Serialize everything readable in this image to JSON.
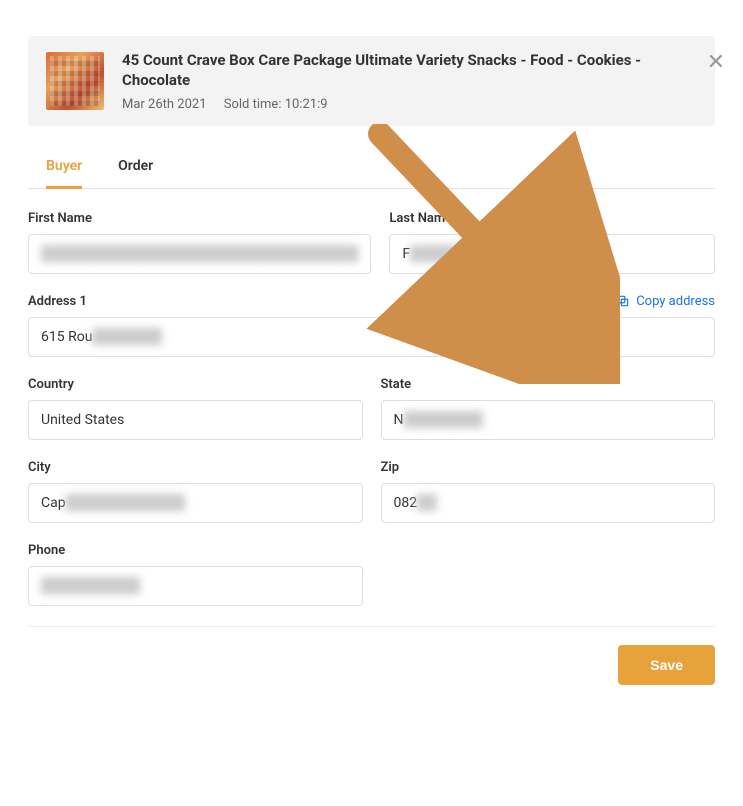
{
  "close_symbol": "✕",
  "header": {
    "title": "45 Count Crave Box Care Package Ultimate Variety Snacks - Food - Cookies - Chocolate",
    "date": "Mar 26th 2021",
    "sold_time_label": "Sold time: 10:21:9"
  },
  "tabs": {
    "buyer": "Buyer",
    "order": "Order"
  },
  "labels": {
    "first_name": "First Name",
    "last_name": "Last Name",
    "address1": "Address 1",
    "copy_address": "Copy address",
    "country": "Country",
    "state": "State",
    "city": "City",
    "zip": "Zip",
    "phone": "Phone"
  },
  "values": {
    "first_name_blur": "████████████████████████████████",
    "last_name_clear": "F",
    "last_name_blur": "█████████",
    "address1_clear": "615 Rou",
    "address1_blur": "███████",
    "country": "United States",
    "state_clear": "N",
    "state_blur": "████████",
    "city_clear": "Cap",
    "city_blur": "████████████",
    "zip_clear": "082",
    "zip_blur": "██",
    "phone_blur": "██████████"
  },
  "buttons": {
    "save": "Save"
  }
}
